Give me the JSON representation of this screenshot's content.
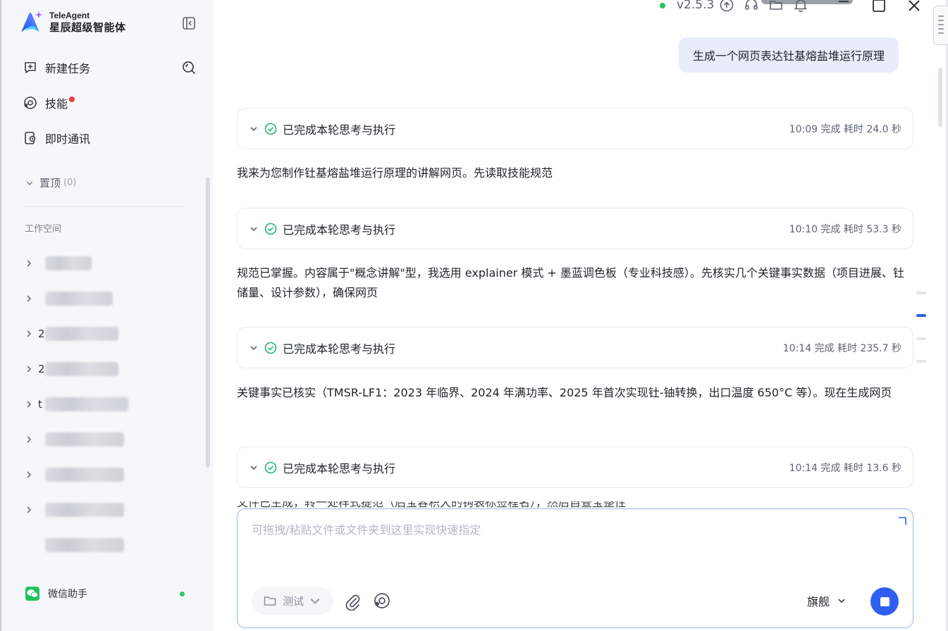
{
  "app": {
    "brand_en": "TeleAgent",
    "brand_zh": "星辰超级智能体",
    "version": "v2.5.3",
    "status_color": "#22c55e",
    "accent_color": "#2f5ff0"
  },
  "sidebar": {
    "nav": [
      {
        "label": "新建任务",
        "icon": "new-task-icon"
      },
      {
        "label": "技能",
        "icon": "skill-icon",
        "badge": "red-dot"
      },
      {
        "label": "即时通讯",
        "icon": "im-icon"
      }
    ],
    "pinned": {
      "label": "置顶",
      "count": "(0)"
    },
    "workspace_title": "工作空间",
    "workspace_items": [
      {
        "prefix": ""
      },
      {
        "prefix": ""
      },
      {
        "prefix": "2"
      },
      {
        "prefix": "2"
      },
      {
        "prefix": "t"
      },
      {
        "prefix": ""
      },
      {
        "prefix": ""
      },
      {
        "prefix": ""
      },
      {
        "prefix": ""
      }
    ],
    "wechat": {
      "label": "微信助手",
      "online_color": "#2dc66c"
    }
  },
  "chat": {
    "user_message": "生成一个网页表达钍基熔盐堆运行原理",
    "steps": [
      {
        "title": "已完成本轮思考与执行",
        "meta": "10:09 完成 耗时 24.0 秒"
      },
      {
        "title": "已完成本轮思考与执行",
        "meta": "10:10 完成 耗时 53.3 秒"
      },
      {
        "title": "已完成本轮思考与执行",
        "meta": "10:14 完成 耗时 235.7 秒"
      },
      {
        "title": "已完成本轮思考与执行",
        "meta": "10:14 完成 耗时 13.6 秒"
      }
    ],
    "messages": [
      "我来为您制作钍基熔盐堆运行原理的讲解网页。先读取技能规范",
      "规范已掌握。内容属于\"概念讲解\"型，我选用 explainer 模式 + 墨蓝调色板（专业科技感）。先核实几个关键事实数据（项目进展、钍储量、设计参数），确保网页",
      "关键事实已核实（TMSR-LF1：2023 年临界、2024 年满功率、2025 年首次实现钍-铀转换，出口温度 650°C 等）。现在生成网页",
      "文件已生成，转一处样式提范（后宝容积大的钩表标签程名），然后自查宝整性"
    ]
  },
  "composer": {
    "placeholder": "可拖拽/粘贴文件或文件夹到这里实现快速指定",
    "folder_label": "测试",
    "model_label": "旗舰"
  }
}
